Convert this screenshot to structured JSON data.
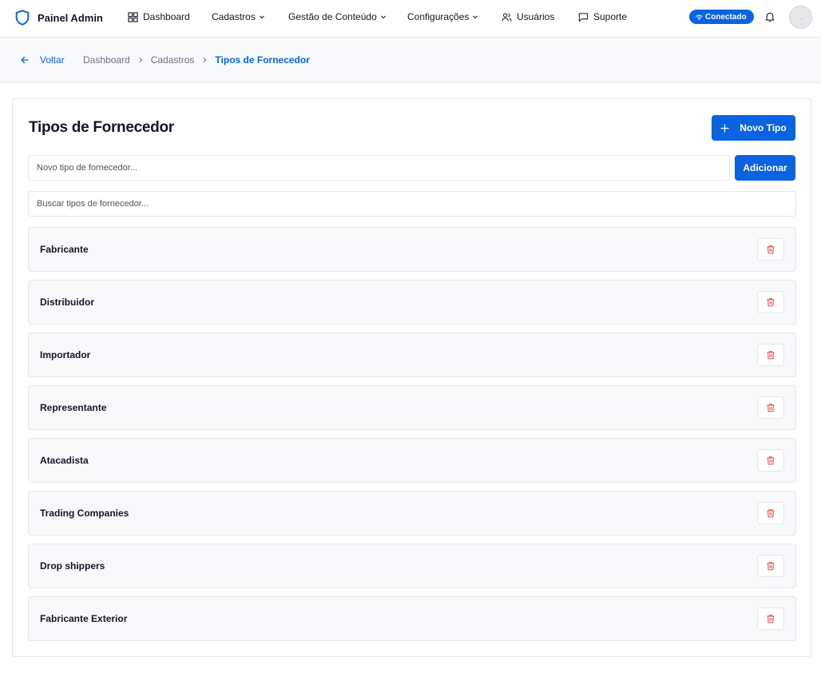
{
  "brand": {
    "name": "Painel Admin",
    "icon": "shield-icon"
  },
  "nav": {
    "dashboard": "Dashboard",
    "cadastros": "Cadastros",
    "gestao": "Gestão de Conteúdo",
    "config": "Configurações",
    "usuarios": "Usuários",
    "suporte": "Suporte"
  },
  "status": {
    "label": "Conectado",
    "color": "#0a63e0"
  },
  "breadcrumb": {
    "back": "Voltar",
    "items": [
      "Dashboard",
      "Cadastros",
      "Tipos de Fornecedor"
    ]
  },
  "page": {
    "title": "Tipos de Fornecedor",
    "new_button": "Novo Tipo",
    "add_button": "Adicionar",
    "new_placeholder": "Novo tipo de fornecedor...",
    "search_placeholder": "Buscar tipos de fornecedor..."
  },
  "types": [
    "Fabricante",
    "Distribuidor",
    "Importador",
    "Representante",
    "Atacadista",
    "Trading Companies",
    "Drop shippers",
    "Fabricante Exterior"
  ],
  "colors": {
    "accent": "#0a63e0",
    "danger": "#e5484d"
  }
}
